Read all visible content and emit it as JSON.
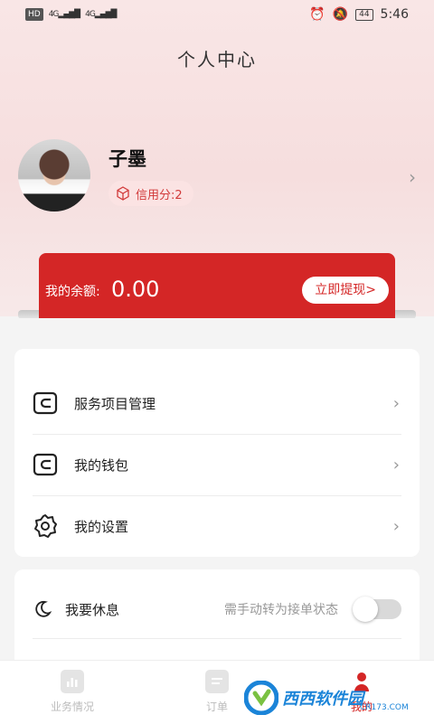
{
  "status_bar": {
    "left_tag": "HD",
    "signal1": "4G",
    "signal2": "4G",
    "battery": "44",
    "time": "5:46"
  },
  "page": {
    "title": "个人中心"
  },
  "profile": {
    "username": "子墨",
    "credit": "信用分:2"
  },
  "balance": {
    "label": "我的余额:",
    "value": "0.00",
    "withdraw_label": "立即提现>"
  },
  "menu": {
    "items": [
      {
        "label": "服务项目管理",
        "icon": "wallet-icon"
      },
      {
        "label": "我的钱包",
        "icon": "wallet-icon"
      },
      {
        "label": "我的设置",
        "icon": "gear-icon"
      }
    ]
  },
  "rest": {
    "label": "我要休息",
    "hint": "需手动转为接单状态",
    "toggle_on": false
  },
  "tabbar": {
    "tabs": [
      {
        "label": "业务情况"
      },
      {
        "label": "订单"
      },
      {
        "label": "我的"
      }
    ]
  },
  "watermark": {
    "text": "西西软件园",
    "sub": "CR173.COM"
  },
  "colors": {
    "accent": "#d42626",
    "pill_bg": "#fbe3e3"
  }
}
